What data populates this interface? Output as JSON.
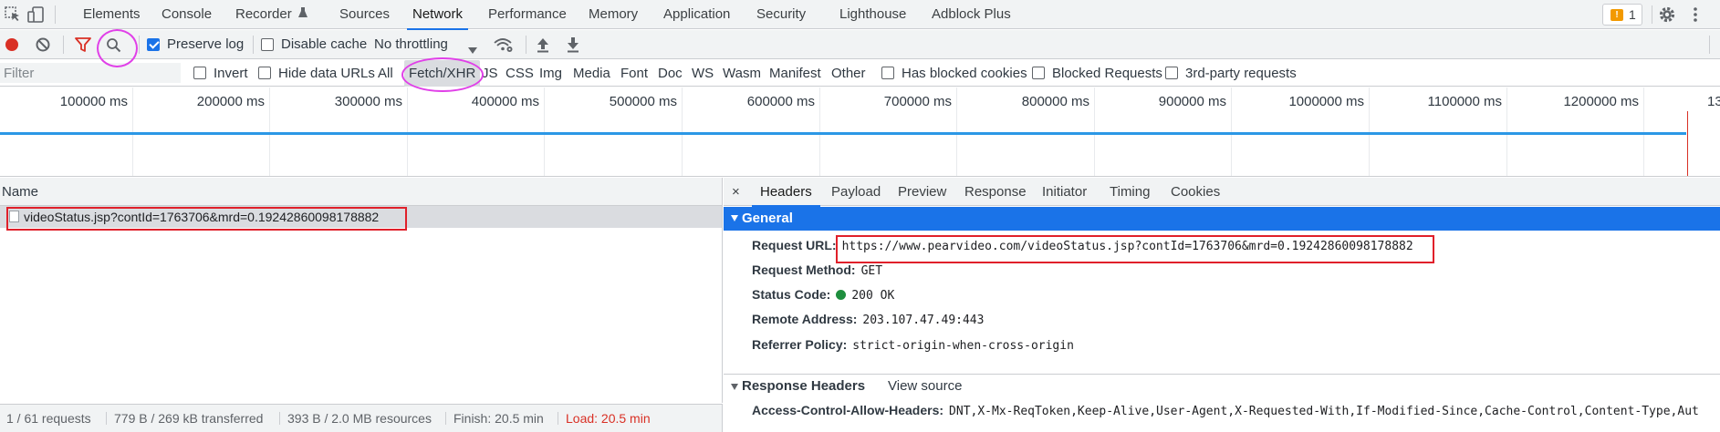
{
  "main_tabs": {
    "items": [
      "Elements",
      "Console",
      "Recorder",
      "Sources",
      "Network",
      "Performance",
      "Memory",
      "Application",
      "Security",
      "Lighthouse",
      "Adblock Plus"
    ],
    "active": "Network",
    "warning_count": "1",
    "icons": {
      "inspect": "cursor-select-icon",
      "device": "device-toggle-icon",
      "recorder": "flask-icon",
      "warning": "warning-icon",
      "settings": "gear-icon",
      "more": "kebab-menu-icon"
    }
  },
  "toolbar": {
    "preserve_log": {
      "label": "Preserve log",
      "checked": true
    },
    "disable_cache": {
      "label": "Disable cache",
      "checked": false
    },
    "throttling": "No throttling",
    "icons": [
      "record-icon",
      "clear-icon",
      "filter-icon",
      "search-icon",
      "wifi-settings-icon",
      "upload-icon",
      "download-icon"
    ]
  },
  "filter_row": {
    "placeholder": "Filter",
    "invert": "Invert",
    "hide_data_urls": "Hide data URLs",
    "types": [
      "All",
      "Fetch/XHR",
      "JS",
      "CSS",
      "Img",
      "Media",
      "Font",
      "Doc",
      "WS",
      "Wasm",
      "Manifest",
      "Other"
    ],
    "selected_type": "Fetch/XHR",
    "has_blocked_cookies": "Has blocked cookies",
    "blocked_requests": "Blocked Requests",
    "third_party": "3rd-party requests"
  },
  "overview": {
    "ticks": [
      "100000 ms",
      "200000 ms",
      "300000 ms",
      "400000 ms",
      "500000 ms",
      "600000 ms",
      "700000 ms",
      "800000 ms",
      "900000 ms",
      "1000000 ms",
      "1100000 ms",
      "1200000 ms",
      "13"
    ]
  },
  "request_list": {
    "header": "Name",
    "rows": [
      {
        "name": "videoStatus.jsp?contId=1763706&mrd=0.19242860098178882"
      }
    ]
  },
  "status_bar": {
    "requests": "1 / 61 requests",
    "transferred": "779 B / 269 kB transferred",
    "resources": "393 B / 2.0 MB resources",
    "finish": "Finish: 20.5 min",
    "load": "Load: 20.5 min"
  },
  "details": {
    "close": "×",
    "tabs": [
      "Headers",
      "Payload",
      "Preview",
      "Response",
      "Initiator",
      "Timing",
      "Cookies"
    ],
    "active_tab": "Headers",
    "general": {
      "title": "General",
      "rows": [
        {
          "key": "Request URL:",
          "value": "https://www.pearvideo.com/videoStatus.jsp?contId=1763706&mrd=0.19242860098178882"
        },
        {
          "key": "Request Method:",
          "value": "GET"
        },
        {
          "key": "Status Code:",
          "value": "200 OK"
        },
        {
          "key": "Remote Address:",
          "value": "203.107.47.49:443"
        },
        {
          "key": "Referrer Policy:",
          "value": "strict-origin-when-cross-origin"
        }
      ]
    },
    "response_headers": {
      "title": "Response Headers",
      "view_source": "View source",
      "rows": [
        {
          "key": "Access-Control-Allow-Headers:",
          "value": "DNT,X-Mx-ReqToken,Keep-Alive,User-Agent,X-Requested-With,If-Modified-Since,Cache-Control,Content-Type,Aut"
        }
      ]
    }
  },
  "colors": {
    "accent": "#1a73e8",
    "annotation_red": "#e0202a",
    "annotation_magenta": "#e040e8",
    "status_green": "#1e8e3e",
    "load_red": "#d93025"
  }
}
